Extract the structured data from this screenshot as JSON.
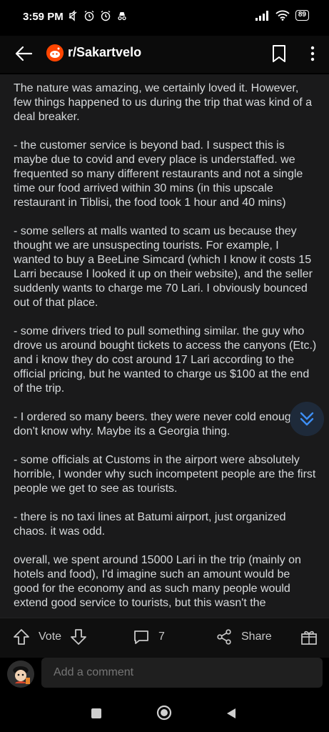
{
  "status_bar": {
    "time": "3:59 PM",
    "battery": "89",
    "icons_left": [
      "mute-icon",
      "alarm-icon",
      "alarm-icon",
      "incognito-icon"
    ],
    "icons_right": [
      "signal-icon",
      "wifi-icon",
      "battery-icon"
    ]
  },
  "header": {
    "subreddit": "r/Sakartvelo"
  },
  "post": {
    "paragraphs": [
      "The nature was amazing, we certainly loved it. However, few things happened to us during the trip that was kind of a deal breaker.",
      "- the customer service is beyond bad. I suspect this is maybe due to covid and every place is understaffed. we frequented so many different restaurants and not a single time our food arrived within 30 mins (in this upscale restaurant in Tiblisi, the food took 1 hour and 40 mins)",
      "- some sellers at malls wanted to scam us because they thought we are unsuspecting tourists. For example, I wanted to buy a BeeLine Simcard (which I know it costs 15 Larri because I looked it up on their website), and the seller suddenly wants to charge me 70 Lari. I obviously bounced out of that place.",
      "- some drivers tried to pull something similar. the guy who drove us around bought tickets to access the canyons (Etc.) and i know they do cost around 17 Lari according to the official pricing, but he wanted to charge us $100 at the end of the trip.",
      "- I ordered so many beers. they were never cold enough, i don't know why. Maybe its a Georgia thing.",
      "- some officials at Customs in the airport were absolutely horrible, I wonder why such incompetent people are the first people we get to see as tourists.",
      "- there is no taxi lines at Batumi airport, just organized chaos. it was odd.",
      "overall, we spent around 15000 Lari in the trip (mainly on hotels and food), I'd imagine such an amount would be good for the economy and as such many people would extend good service to tourists, but this wasn't the"
    ]
  },
  "actions": {
    "vote_label": "Vote",
    "comment_count": "7",
    "share_label": "Share"
  },
  "comment": {
    "placeholder": "Add a comment"
  },
  "colors": {
    "background": "#1a1a1b",
    "text": "#d7dadc",
    "accent_blue": "#3d8ff5",
    "brand_orange": "#ff4500"
  }
}
